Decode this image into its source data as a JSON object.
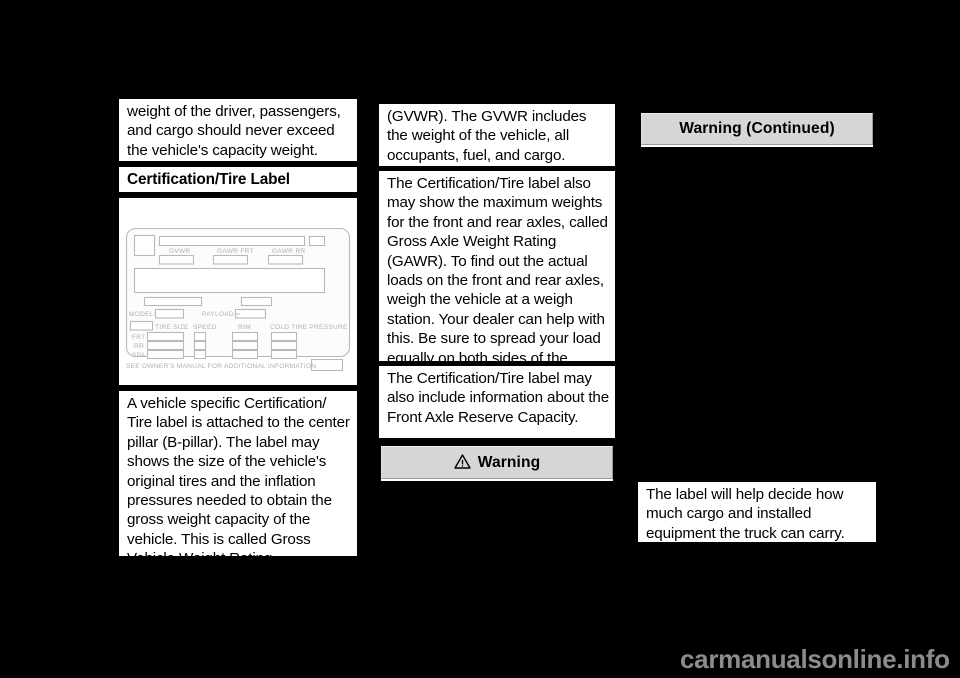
{
  "page": {
    "background_color": "#000000",
    "text_block_color": "#ffffff",
    "warning_box_color": "#d6d6d6"
  },
  "column_left": {
    "paragraph_continued": "weight of the driver, passengers, and cargo should never exceed the vehicle's capacity weight.",
    "heading": "Certification/Tire Label",
    "figure": {
      "name": "certification-tire-label-illustration",
      "fields": {
        "gvwr": "GVWR",
        "gawr_frt": "GAWR FRT",
        "gawr_rr": "GAWR RR",
        "model": "MODEL:",
        "payload": "PAYLOAD =",
        "tire_size": "TIRE SIZE",
        "speed": "SPEED",
        "rim": "RIM",
        "cold_tire_pressure": "COLD TIRE PRESSURE",
        "row_frt": "FRT",
        "row_rr": "RR",
        "row_spa": "SPA",
        "footer": "SEE OWNER'S MANUAL FOR ADDITIONAL INFORMATION"
      }
    },
    "paragraph_body": "A vehicle specific Certification/ Tire label is attached to the center pillar (B-pillar). The label may shows the size of the vehicle's original tires and the inflation pressures needed to obtain the gross weight capacity of the vehicle. This is called Gross Vehicle Weight Rating"
  },
  "column_middle": {
    "paragraph_gvwr": "(GVWR). The GVWR includes the weight of the vehicle, all occupants, fuel, and cargo.",
    "paragraph_gawr": "The Certification/Tire label also may show the maximum weights for the front and rear axles, called Gross Axle Weight Rating (GAWR). To find out the actual loads on the front and rear axles, weigh the vehicle at a weigh station. Your dealer can help with this. Be sure to spread your load equally on both sides of the centerline.",
    "paragraph_reserve": "The Certification/Tire label may also include information about the Front Axle Reserve Capacity.",
    "warning_label": "Warning"
  },
  "column_right": {
    "warning_continued_label": "Warning  (Continued)",
    "paragraph_label_help": "The label will help decide how much cargo and installed equipment the truck can carry."
  },
  "footer": {
    "watermark": "carmanualsonline.info"
  }
}
